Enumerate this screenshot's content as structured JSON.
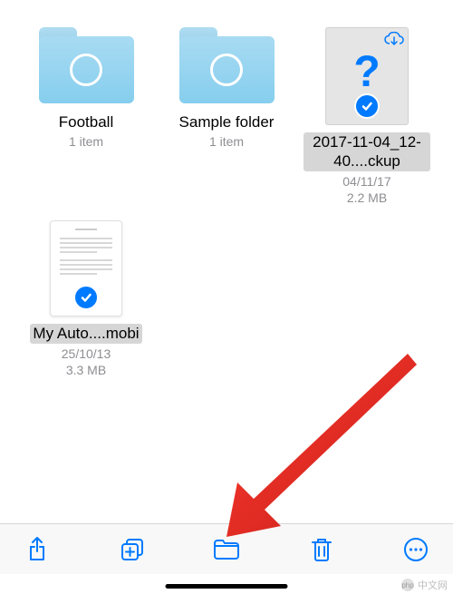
{
  "items": [
    {
      "type": "folder",
      "name": "Football",
      "meta": "1 item"
    },
    {
      "type": "folder",
      "name": "Sample folder",
      "meta": "1 item"
    },
    {
      "type": "file-unknown",
      "name": "2017-11-04_12-40....ckup",
      "date": "04/11/17",
      "size": "2.2 MB",
      "selected": true,
      "cloudDownload": true
    },
    {
      "type": "file-doc",
      "name": "My Auto....mobi",
      "date": "25/10/13",
      "size": "3.3 MB",
      "selected": true
    }
  ],
  "toolbar": {
    "share": "share-icon",
    "duplicate": "duplicate-icon",
    "move": "folder-icon",
    "delete": "trash-icon",
    "more": "more-icon"
  },
  "watermark": "中文网",
  "watermarkPrefix": "php"
}
